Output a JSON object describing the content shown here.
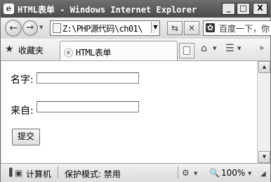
{
  "window": {
    "title": "HTML表单 - Windows Internet Explorer",
    "minimize_glyph": "_",
    "maximize_glyph": "□",
    "close_glyph": "X"
  },
  "addressbar": {
    "url": "Z:\\PHP源代码\\ch01\\",
    "refresh_icon": "refresh-icon",
    "stop_icon": "stop-icon"
  },
  "search": {
    "text": "百度一下，你"
  },
  "favorites": {
    "label": "收藏夹"
  },
  "tab": {
    "title": "HTML表单"
  },
  "form": {
    "name_label": "名字:",
    "from_label": "来自:",
    "name_value": "",
    "from_value": "",
    "submit_label": "提交"
  },
  "statusbar": {
    "zone": "计算机",
    "protected_mode": "保护模式: 禁用",
    "zoom": "100%"
  }
}
